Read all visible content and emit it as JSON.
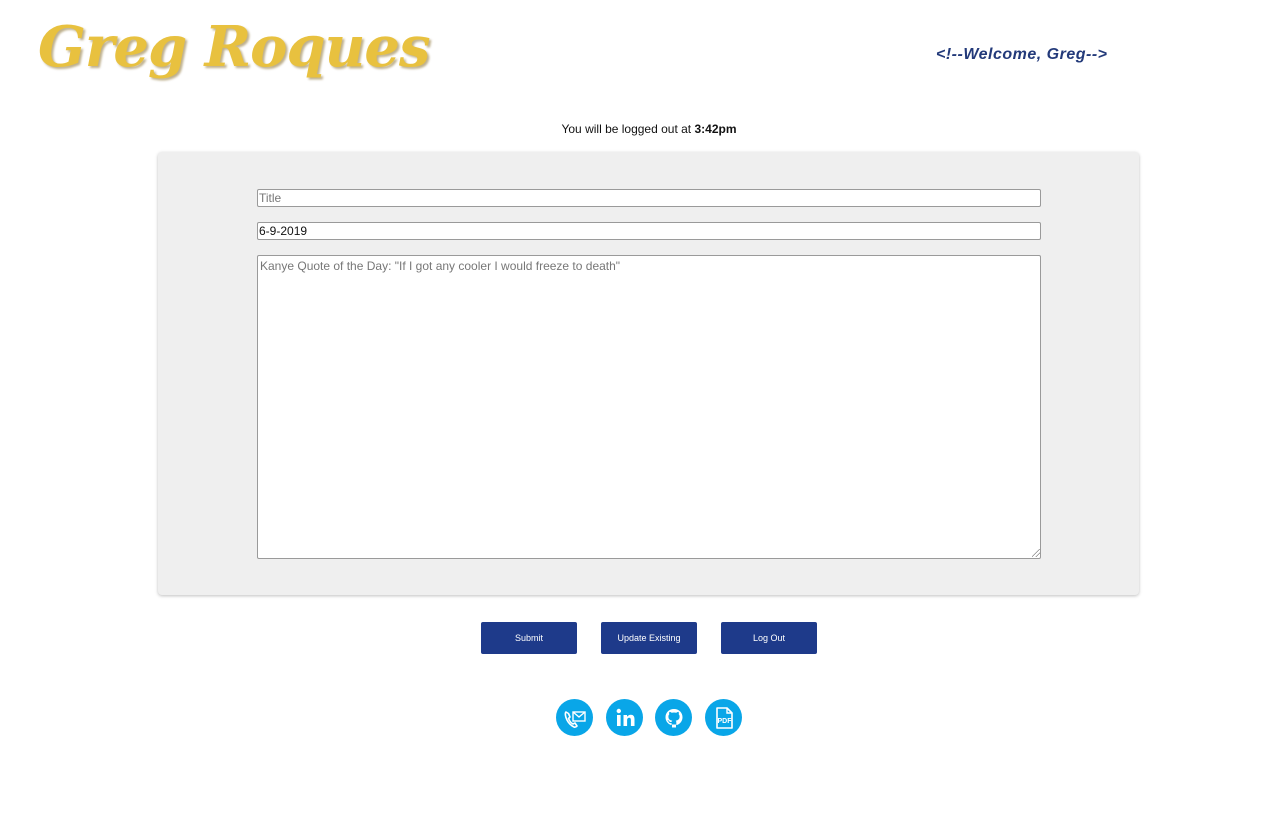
{
  "header": {
    "brand": "Greg Roques",
    "welcome": "<!--Welcome, Greg-->"
  },
  "session": {
    "notice_prefix": "You will be logged out at",
    "logout_time": "3:42pm"
  },
  "form": {
    "title_placeholder": "Title",
    "title_value": "",
    "date_value": "6-9-2019",
    "body_placeholder": "Kanye Quote of the Day: \"If I got any cooler I would freeze to death\"",
    "body_value": ""
  },
  "actions": {
    "submit_label": "Submit",
    "update_label": "Update Existing",
    "logout_label": "Log Out"
  },
  "social": [
    {
      "icon": "phone-mail-icon"
    },
    {
      "icon": "linkedin-icon"
    },
    {
      "icon": "github-icon"
    },
    {
      "icon": "pdf-icon"
    }
  ],
  "colors": {
    "brand": "#e8c13f",
    "navy": "#1e3a8a",
    "social": "#09a6e8",
    "panel": "#efefef"
  }
}
